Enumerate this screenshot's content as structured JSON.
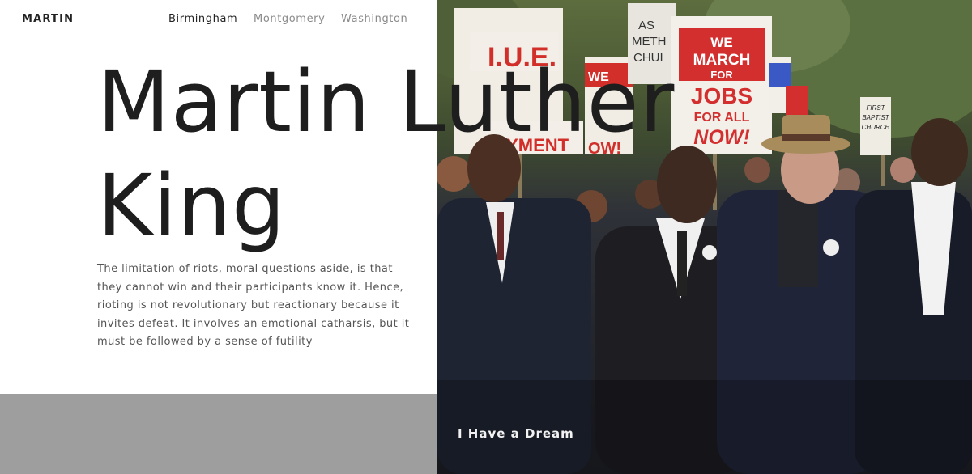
{
  "brand": "MARTIN",
  "nav": {
    "items": [
      {
        "label": "Birmingham",
        "active": true
      },
      {
        "label": "Montgomery",
        "active": false
      },
      {
        "label": "Washington",
        "active": false
      }
    ]
  },
  "hero": {
    "title_line1": "Martin Luther",
    "title_line2": "King",
    "text": "The limitation of riots, moral questions aside, is that they cannot win and their participants know it. Hence, rioting is not revolutionary but reactionary because it invites defeat. It involves an emotional catharsis, but it must be followed by a sense of futility"
  },
  "photo": {
    "caption": "I Have a Dream",
    "signs": {
      "sign1_line1": "I.U.E.",
      "sign2_line1": "WE",
      "sign2_line2": "MARCH",
      "sign2_line3": "FOR",
      "sign2_line4": "JOBS",
      "sign2_line5": "FOR ALL",
      "sign2_line6": "NOW!",
      "sign3_line1": "FIRST",
      "sign3_line2": "BAPTIST",
      "sign3_line3": "CHURCH"
    }
  },
  "colors": {
    "accent_red": "#d32f2f",
    "gray_block": "#9e9e9e",
    "title": "#1e1e1e"
  }
}
